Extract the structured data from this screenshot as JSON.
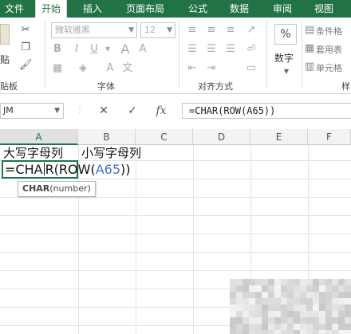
{
  "ribbon_tabs": [
    {
      "label": "文件",
      "active": false
    },
    {
      "label": "开始",
      "active": true
    },
    {
      "label": "插入",
      "active": false
    },
    {
      "label": "页面布局",
      "active": false
    },
    {
      "label": "公式",
      "active": false
    },
    {
      "label": "数据",
      "active": false
    },
    {
      "label": "审阅",
      "active": false
    },
    {
      "label": "视图",
      "active": false
    }
  ],
  "ribbon": {
    "paste_label": "贴",
    "clipboard_group": "贴板",
    "font_name": "微软雅黑",
    "font_size": "12",
    "font_group": "字体",
    "align_group": "对齐方式",
    "number_label": "数字",
    "number_symbol": "%",
    "styles_items": [
      "条件格",
      "套用表",
      "单元格"
    ],
    "styles_group": "样"
  },
  "formula_bar": {
    "name_box": "JM",
    "cancel_symbol": "✕",
    "enter_symbol": "✓",
    "fx_symbol": "fx",
    "formula": "=CHAR(ROW(A65))"
  },
  "columns": [
    "A",
    "B",
    "C",
    "D",
    "E",
    "F"
  ],
  "cells": {
    "A1": "大写字母列",
    "B1": "小写字母列"
  },
  "edit": {
    "prefix": "=CHA",
    "middle": "R(ROW(",
    "ref": "A65",
    "suffix": "))"
  },
  "tooltip": {
    "func": "CHAR",
    "args": "(number)"
  },
  "colors": {
    "accent": "#217346",
    "reference": "#4472c4"
  }
}
